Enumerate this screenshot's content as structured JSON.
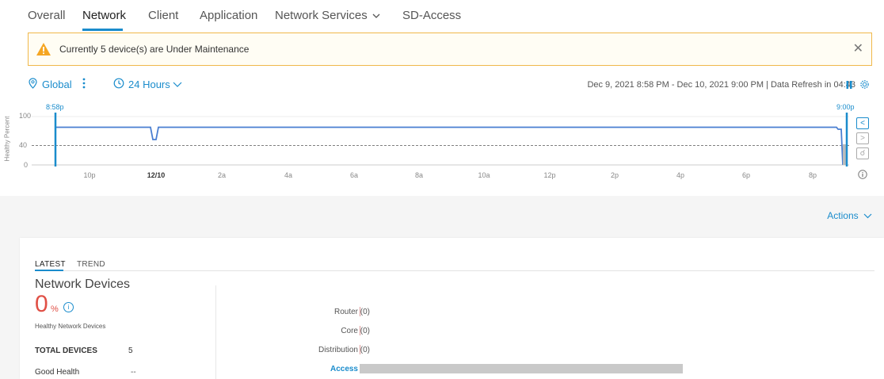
{
  "tabs": [
    {
      "label": "Overall"
    },
    {
      "label": "Network"
    },
    {
      "label": "Client"
    },
    {
      "label": "Application"
    },
    {
      "label": "Network Services"
    },
    {
      "label": "SD-Access"
    }
  ],
  "alert": {
    "text": "Currently 5 device(s) are Under Maintenance",
    "icon": "warning-icon",
    "close": "✕",
    "color": "#f0b84b"
  },
  "filter": {
    "location": "Global",
    "time_range": "24 Hours",
    "date_range": "Dec 9, 2021 8:58 PM - Dec 10, 2021 9:00 PM | Data Refresh in 04:43"
  },
  "timeline": {
    "ylabel": "Healthy Percent",
    "yticks": [
      "100",
      "40",
      "0"
    ],
    "start_label": "8:58p",
    "end_label": "9:00p",
    "xticks": [
      "10p",
      "12/10",
      "2a",
      "4a",
      "6a",
      "8a",
      "10a",
      "12p",
      "2p",
      "4p",
      "6p",
      "8p"
    ],
    "threshold": 40,
    "color": "#4a7fd1"
  },
  "actions_label": "Actions",
  "card": {
    "subtabs": [
      "LATEST",
      "TREND"
    ],
    "title": "Network Devices",
    "healthy_percent": "0",
    "percent_symbol": "%",
    "healthy_label": "Healthy Network Devices",
    "total_label": "TOTAL DEVICES",
    "total_value": "5",
    "good_label": "Good Health",
    "good_value": "--",
    "bars": [
      {
        "label": "Router (0)",
        "value": 0
      },
      {
        "label": "Core (0)",
        "value": 0
      },
      {
        "label": "Distribution (0)",
        "value": 0
      },
      {
        "label": "Access (2)",
        "value": 2
      }
    ]
  }
}
